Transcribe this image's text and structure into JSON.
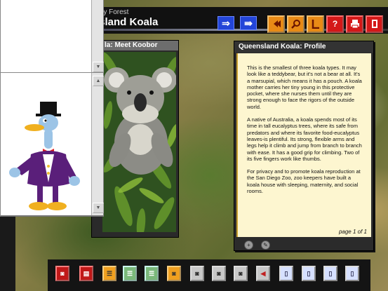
{
  "header": {
    "breadcrumb": "ry Forest",
    "page_title": "nsland Koala"
  },
  "nav": {
    "back_glyph": "⇒",
    "forward_glyph": "⇛"
  },
  "toolbar_icons": [
    "back-icon",
    "search-icon",
    "bookmark-icon",
    "help-icon",
    "print-icon",
    "exit-icon"
  ],
  "photo_panel": {
    "title": "la: Meet Koobor"
  },
  "profile": {
    "title": "Queensland Koala: Profile",
    "paragraphs": [
      "This is the smallest of three koala types. It may look like a teddybear, but it's not a bear at all. It's a marsupial, which means it has a pouch. A koala mother carries her tiny young in this protective pocket, where she nurses them until they are strong enough to face the rigors of the outside world.",
      "A native of Australia, a koala spends most of its time in tall eucalyptus trees, where its safe from predators and where its favorite food-eucalyptus leaves-is plentiful. Its strong, flexible arms and legs help it climb and jump from branch to branch with ease. It has a good grip for climbing. Two of its five fingers work like thumbs.",
      "For privacy and to promote koala reproduction at the San Diego Zoo, zoo keepers have built a koala house with sleeping, maternity, and social rooms."
    ],
    "page_indicator": "page 1 of 1"
  },
  "bottom_toolbar": [
    {
      "name": "camera-icon",
      "color": "red"
    },
    {
      "name": "document-icon",
      "color": "red"
    },
    {
      "name": "film-icon",
      "color": "orange"
    },
    {
      "name": "film-icon",
      "color": "green"
    },
    {
      "name": "film-icon",
      "color": "green"
    },
    {
      "name": "camera-icon",
      "color": "orange"
    },
    {
      "name": "camera-icon",
      "color": "gray"
    },
    {
      "name": "camera-icon",
      "color": "gray"
    },
    {
      "name": "camera-icon",
      "color": "gray"
    },
    {
      "name": "speaker-icon",
      "color": "gray"
    },
    {
      "name": "page-icon",
      "color": "blue"
    },
    {
      "name": "page-icon",
      "color": "blue"
    },
    {
      "name": "page-icon",
      "color": "blue"
    },
    {
      "name": "page-icon",
      "color": "blue"
    }
  ],
  "colors": {
    "nav_blue": "#2345d8",
    "toolbar_orange": "#e88a16",
    "toolbar_red": "#d41818",
    "profile_paper": "#fdf6d0"
  }
}
